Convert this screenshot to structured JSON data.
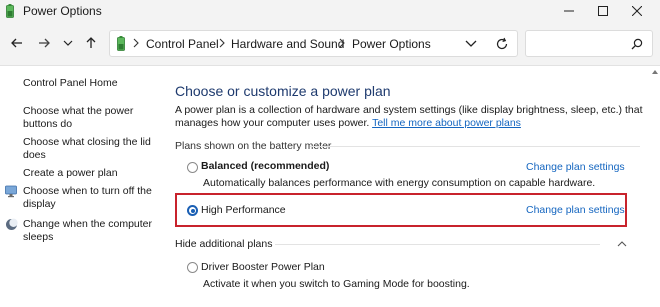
{
  "window": {
    "title": "Power Options",
    "app_icon": "battery-icon",
    "controls": [
      "minimize-icon",
      "maximize-icon",
      "close-icon"
    ]
  },
  "nav": {
    "buttons": [
      "back-arrow-icon",
      "forward-arrow-icon",
      "recent-dropdown-icon",
      "up-arrow-icon"
    ],
    "breadcrumb": [
      "Control Panel",
      "Hardware and Sound",
      "Power Options"
    ],
    "search": {
      "value": "",
      "placeholder": ""
    }
  },
  "sidebar": {
    "items": [
      {
        "label": "Control Panel Home",
        "icon": ""
      },
      {
        "label": "Choose what the power buttons do",
        "icon": ""
      },
      {
        "label": "Choose what closing the lid does",
        "icon": ""
      },
      {
        "label": "Create a power plan",
        "icon": ""
      },
      {
        "label": "Choose when to turn off the display",
        "icon": "monitor-shield-icon"
      },
      {
        "label": "Change when the computer sleeps",
        "icon": "moon-sleep-icon"
      }
    ]
  },
  "main": {
    "title": "Choose or customize a power plan",
    "description": "A power plan is a collection of hardware and system settings (like display brightness, sleep, etc.) that manages how your computer uses power.",
    "description_link": "Tell me more about power plans",
    "plans_section_label": "Plans shown on the battery meter",
    "plans": [
      {
        "name": "Balanced (recommended)",
        "description": "Automatically balances performance with energy consumption on capable hardware.",
        "link": "Change plan settings",
        "selected": false
      },
      {
        "name": "High Performance",
        "description": "",
        "link": "Change plan settings",
        "selected": true
      }
    ],
    "hidden_section_label": "Hide additional plans",
    "hidden_plans": [
      {
        "name": "Driver Booster Power Plan",
        "description": "Activate it when you switch to Gaming Mode for boosting.",
        "selected": false
      }
    ]
  },
  "colors": {
    "title_blue": "#1e3a6e",
    "link_blue": "#1566c0",
    "highlight_red": "#c8232c",
    "radio_selected": "#1a5fb4"
  }
}
